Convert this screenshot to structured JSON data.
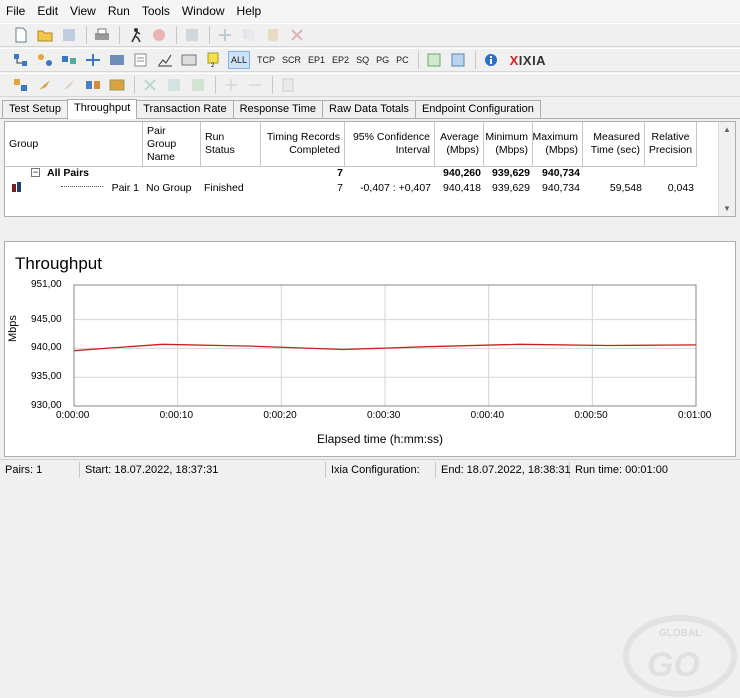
{
  "menu": [
    "File",
    "Edit",
    "View",
    "Run",
    "Tools",
    "Window",
    "Help"
  ],
  "toolbar": {
    "protocols": [
      "ALL",
      "TCP",
      "SCR",
      "EP1",
      "EP2",
      "SQ",
      "PG",
      "PC"
    ],
    "active_protocol": "ALL",
    "vendor": "IXIA",
    "vendor_mark": "X"
  },
  "tabs": [
    "Test Setup",
    "Throughput",
    "Transaction Rate",
    "Response Time",
    "Raw Data Totals",
    "Endpoint Configuration"
  ],
  "active_tab": "Throughput",
  "grid": {
    "headers": {
      "group": "Group",
      "pair_group_name": "Pair Group Name",
      "run_status": "Run Status",
      "timing_records": "Timing Records Completed",
      "confidence": "95% Confidence Interval",
      "average": "Average (Mbps)",
      "minimum": "Minimum (Mbps)",
      "maximum": "Maximum (Mbps)",
      "measured_time": "Measured Time (sec)",
      "relative_precision": "Relative Precision"
    },
    "summary": {
      "expand": "−",
      "label": "All Pairs",
      "timing_records": "7",
      "average": "940,260",
      "minimum": "939,629",
      "maximum": "940,734"
    },
    "rows": [
      {
        "group": "Pair 1",
        "pair_group_name": "No Group",
        "run_status": "Finished",
        "timing_records": "7",
        "confidence": "-0,407 : +0,407",
        "average": "940,418",
        "minimum": "939,629",
        "maximum": "940,734",
        "measured_time": "59,548",
        "relative_precision": "0,043"
      }
    ]
  },
  "chart_data": {
    "type": "line",
    "title": "Throughput",
    "xlabel": "Elapsed time (h:mm:ss)",
    "ylabel": "Mbps",
    "x_ticks": [
      "0:00:00",
      "0:00:10",
      "0:00:20",
      "0:00:30",
      "0:00:40",
      "0:00:50",
      "0:01:00"
    ],
    "y_ticks": [
      "951,00",
      "945,00",
      "940,00",
      "935,00",
      "930,00"
    ],
    "xlim": [
      0,
      60
    ],
    "ylim": [
      930,
      951
    ],
    "grid": true,
    "color": "#cc1f1f",
    "series": [
      {
        "x": [
          0,
          3,
          8.5,
          17,
          26,
          34,
          43,
          51.5,
          60
        ],
        "y": [
          939.6,
          940.0,
          940.7,
          940.4,
          939.8,
          940.3,
          940.7,
          940.5,
          940.6
        ]
      }
    ]
  },
  "watermark": {
    "brand": "GLOBAL",
    "logo": "GO"
  },
  "status": {
    "pairs": "Pairs: 1",
    "start": "Start: 18.07.2022, 18:37:31",
    "ixia_config": "Ixia Configuration:",
    "end": "End: 18.07.2022, 18:38:31",
    "run_time": "Run time: 00:01:00"
  }
}
